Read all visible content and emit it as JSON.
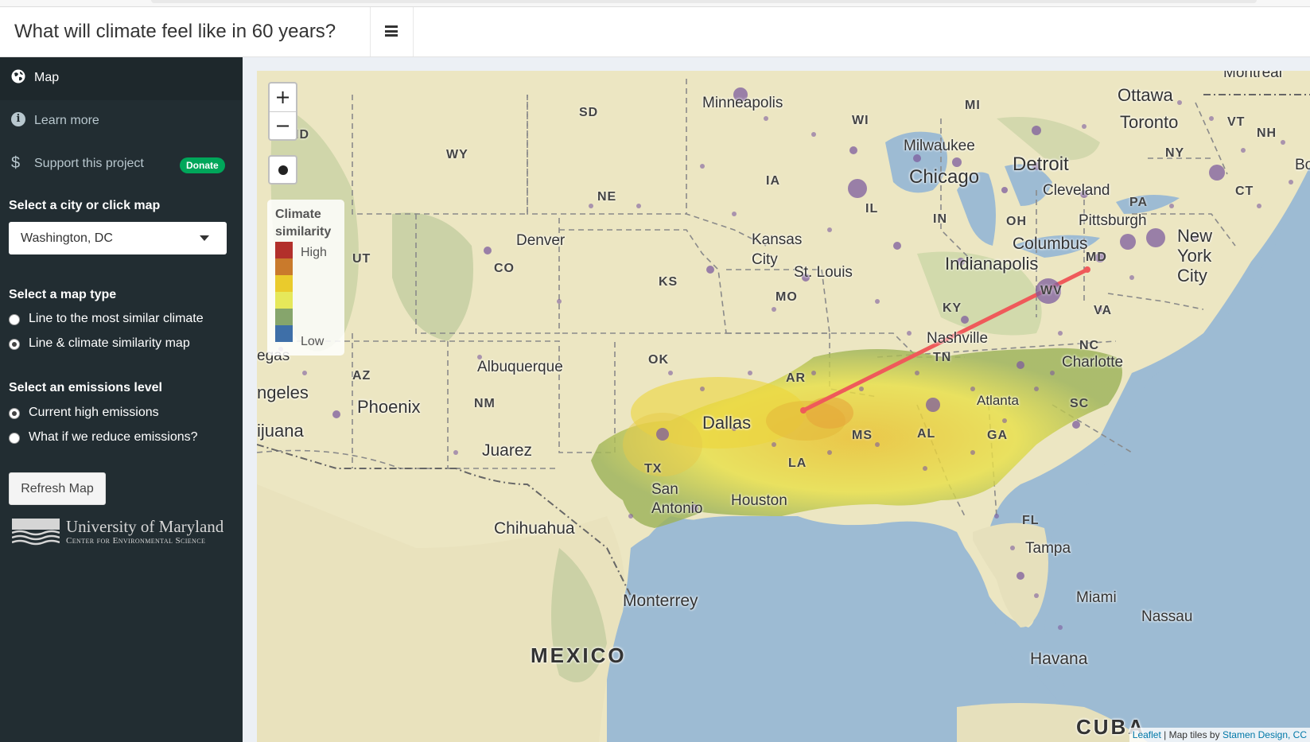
{
  "header": {
    "title": "What will climate feel like in 60 years?"
  },
  "sidebar": {
    "nav": [
      {
        "label": "Map",
        "icon": "globe-icon"
      },
      {
        "label": "Learn more",
        "icon": "info-icon"
      },
      {
        "label": "Support this project",
        "icon": "dollar-icon",
        "badge": "Donate"
      }
    ],
    "city_label": "Select a city or click map",
    "city_value": "Washington, DC",
    "maptype_label": "Select a map type",
    "maptype_options": [
      "Line to the most similar climate",
      "Line & climate similarity map"
    ],
    "maptype_selected": 1,
    "emissions_label": "Select an emissions level",
    "emissions_options": [
      "Current high emissions",
      "What if we reduce emissions?"
    ],
    "emissions_selected": 0,
    "refresh_label": "Refresh Map",
    "umd_name": "University of Maryland",
    "umd_sub": "Center for Environmental Science"
  },
  "map": {
    "zoom_in": "+",
    "zoom_out": "−",
    "legend": {
      "title": "Climate similarity",
      "high": "High",
      "low": "Low",
      "colors": [
        "#b2302b",
        "#c97a2c",
        "#eacb2c",
        "#e6e85a",
        "#86a56c",
        "#3e6fa8"
      ]
    },
    "attribution": {
      "leaflet": "Leaflet",
      "middle": " | Map tiles by ",
      "stamen": "Stamen Design, CC"
    },
    "line_color": "#ef5a5a",
    "labels": {
      "minneapolis": "Minneapolis",
      "ottawa": "Ottawa",
      "toronto": "Toronto",
      "montreal": "Montreal",
      "milwaukee": "Milwaukee",
      "chicago": "Chicago",
      "detroit": "Detroit",
      "cleveland": "Cleveland",
      "pittsburgh": "Pittsburgh",
      "columbus": "Columbus",
      "indianapolis": "Indianapolis",
      "kansas_city": "Kansas\nCity",
      "st_louis": "St. Louis",
      "denver": "Denver",
      "new_york": "New\nYork\nCity",
      "boston": "Bost",
      "nashville": "Nashville",
      "charlotte": "Charlotte",
      "atlanta": "Atlanta",
      "albuquerque": "Albuquerque",
      "phoenix": "Phoenix",
      "juarez": "Juarez",
      "dallas": "Dallas",
      "san_antonio": "San\nAntonio",
      "houston": "Houston",
      "chihuahua": "Chihuahua",
      "monterrey": "Monterrey",
      "tampa": "Tampa",
      "miami": "Miami",
      "nassau": "Nassau",
      "havana": "Havana",
      "vegas": "egas",
      "angeles": "ngeles",
      "tijuana": "ijuana",
      "mexico": "MEXICO",
      "cuba": "CUBA"
    },
    "states": [
      "SD",
      "WY",
      "NE",
      "IA",
      "IL",
      "IN",
      "OH",
      "PA",
      "NY",
      "VT",
      "NH",
      "CT",
      "MI",
      "WI",
      "MD",
      "WV",
      "VA",
      "KY",
      "MO",
      "KS",
      "CO",
      "UT",
      "AZ",
      "NM",
      "OK",
      "TX",
      "AR",
      "TN",
      "NC",
      "SC",
      "GA",
      "AL",
      "MS",
      "LA",
      "FL",
      "ID"
    ]
  }
}
